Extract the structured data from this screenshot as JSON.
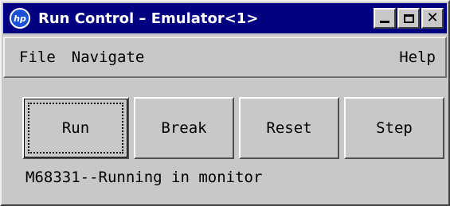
{
  "window": {
    "title": "Run Control – Emulator<1>",
    "app_icon_text": "hp"
  },
  "menu": {
    "file": "File",
    "navigate": "Navigate",
    "help": "Help"
  },
  "buttons": {
    "run": "Run",
    "break": "Break",
    "reset": "Reset",
    "step": "Step"
  },
  "status": {
    "text": "M68331--Running in monitor"
  }
}
